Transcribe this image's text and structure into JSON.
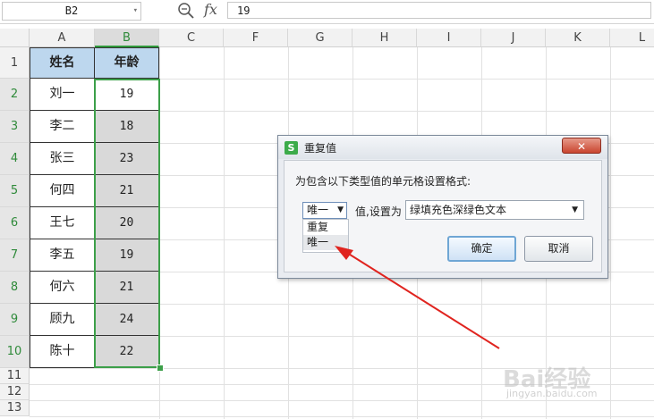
{
  "formula_bar": {
    "cell_ref": "B2",
    "value": "19",
    "fx_icon": "fx"
  },
  "columns": [
    "A",
    "B",
    "C",
    "F",
    "G",
    "H",
    "I",
    "J",
    "K",
    "L"
  ],
  "rows": [
    "1",
    "2",
    "3",
    "4",
    "5",
    "6",
    "7",
    "8",
    "9",
    "10",
    "11",
    "12",
    "13"
  ],
  "table": {
    "headers": [
      "姓名",
      "年龄"
    ],
    "rows": [
      [
        "刘一",
        "19"
      ],
      [
        "李二",
        "18"
      ],
      [
        "张三",
        "23"
      ],
      [
        "何四",
        "21"
      ],
      [
        "王七",
        "20"
      ],
      [
        "李五",
        "19"
      ],
      [
        "何六",
        "21"
      ],
      [
        "顾九",
        "24"
      ],
      [
        "陈十",
        "22"
      ]
    ]
  },
  "dialog": {
    "title": "重复值",
    "prompt": "为包含以下类型值的单元格设置格式:",
    "type_selected": "唯一",
    "type_options": [
      "重复",
      "唯一"
    ],
    "middle_label": "值,设置为",
    "format_selected": "绿填充色深绿色文本",
    "ok_label": "确定",
    "cancel_label": "取消",
    "close_label": "✕"
  },
  "watermark": {
    "text": "Bai经验",
    "sub": "jingyan.baidu.com"
  },
  "colors": {
    "selection": "#3c9f49",
    "header_fill": "#bdd7ee",
    "age_fill": "#d9d9d9",
    "arrow": "#e0241f"
  }
}
